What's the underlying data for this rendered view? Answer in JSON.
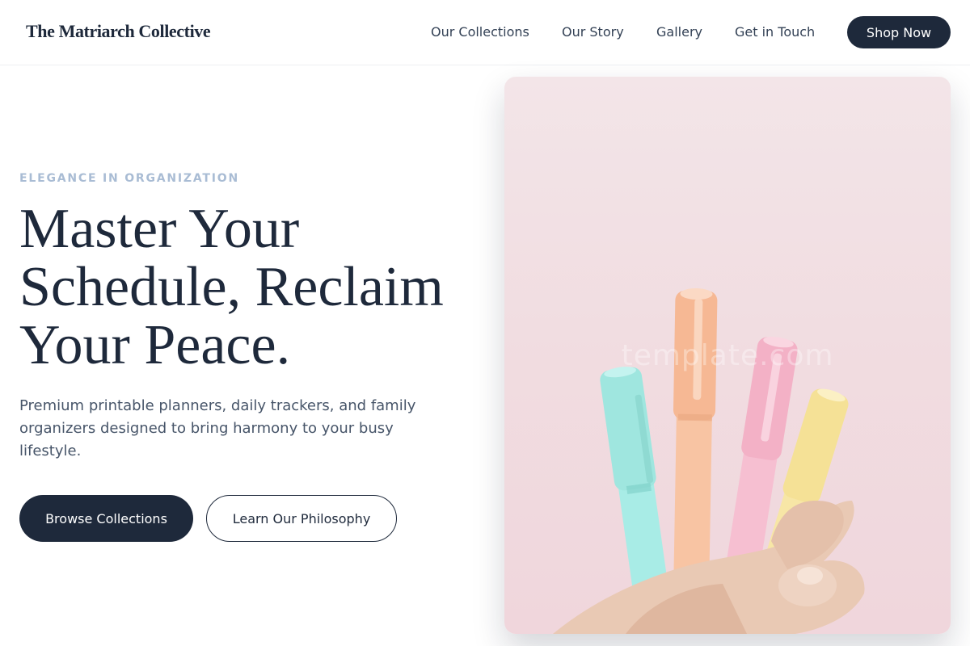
{
  "header": {
    "brand": "The Matriarch Collective",
    "nav": [
      {
        "label": "Our Collections"
      },
      {
        "label": "Our Story"
      },
      {
        "label": "Gallery"
      },
      {
        "label": "Get in Touch"
      }
    ],
    "cta_label": "Shop Now"
  },
  "hero": {
    "eyebrow": "ELEGANCE IN ORGANIZATION",
    "headline_lines": [
      "Master Your",
      "Schedule, Reclaim",
      "Your Peace."
    ],
    "subtext": "Premium printable planners, daily trackers, and family organizers designed to bring harmony to your busy lifestyle.",
    "primary_button": "Browse Collections",
    "secondary_button": "Learn Our Philosophy",
    "image": {
      "subject": "hand holding four pastel highlighter pens",
      "watermark": "template.com"
    }
  },
  "colors": {
    "primary": "#1e293b",
    "eyebrow": "#a9bcd4",
    "body_text": "#475569",
    "image_background": "#f1dde1",
    "pen_teal": "#a8ece6",
    "pen_peach": "#f8c4a3",
    "pen_pink": "#f6bfd1",
    "pen_yellow": "#f7e6a6"
  }
}
